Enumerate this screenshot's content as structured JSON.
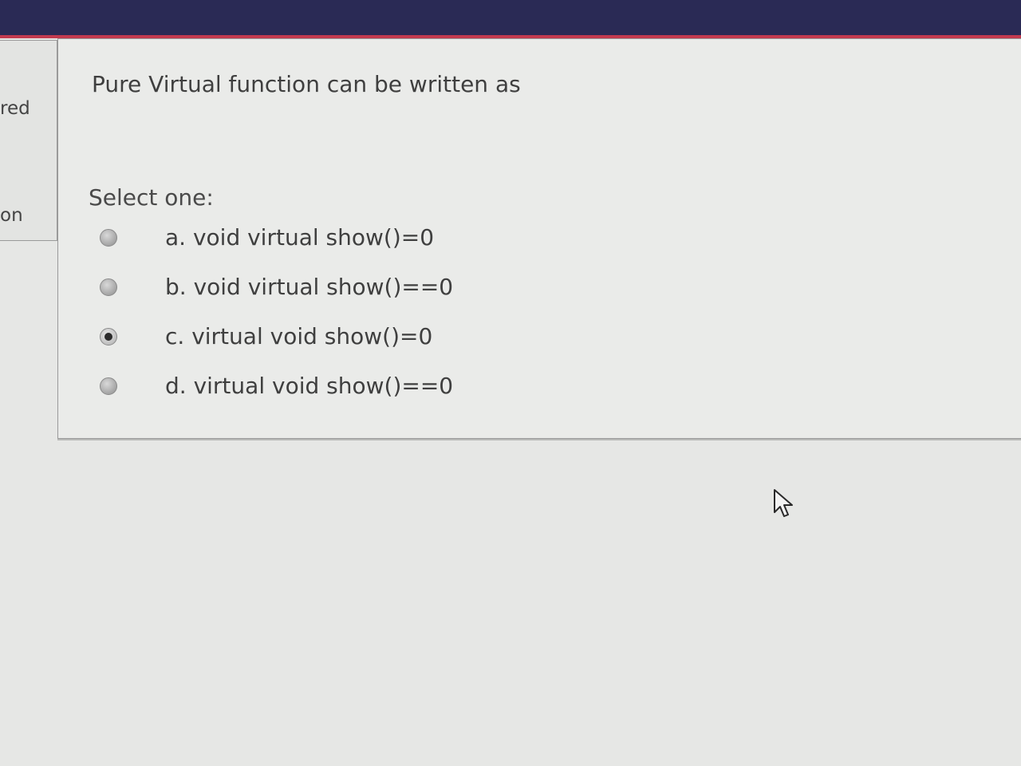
{
  "sidebar": {
    "status_fragment": "red",
    "flag_fragment": "on"
  },
  "question": {
    "text": "Pure Virtual function can be written as",
    "prompt": "Select one:",
    "options": [
      {
        "label": "a. void virtual show()=0",
        "selected": false
      },
      {
        "label": "b. void virtual show()==0",
        "selected": false
      },
      {
        "label": "c. virtual void show()=0",
        "selected": true
      },
      {
        "label": "d. virtual void show()==0",
        "selected": false
      }
    ]
  },
  "icons": {
    "cursor": "mouse-pointer-icon",
    "radio": "radio-button-icon"
  },
  "colors": {
    "header": "#2a2a55",
    "header_accent": "#c23a4f",
    "background": "#e6e7e5"
  }
}
